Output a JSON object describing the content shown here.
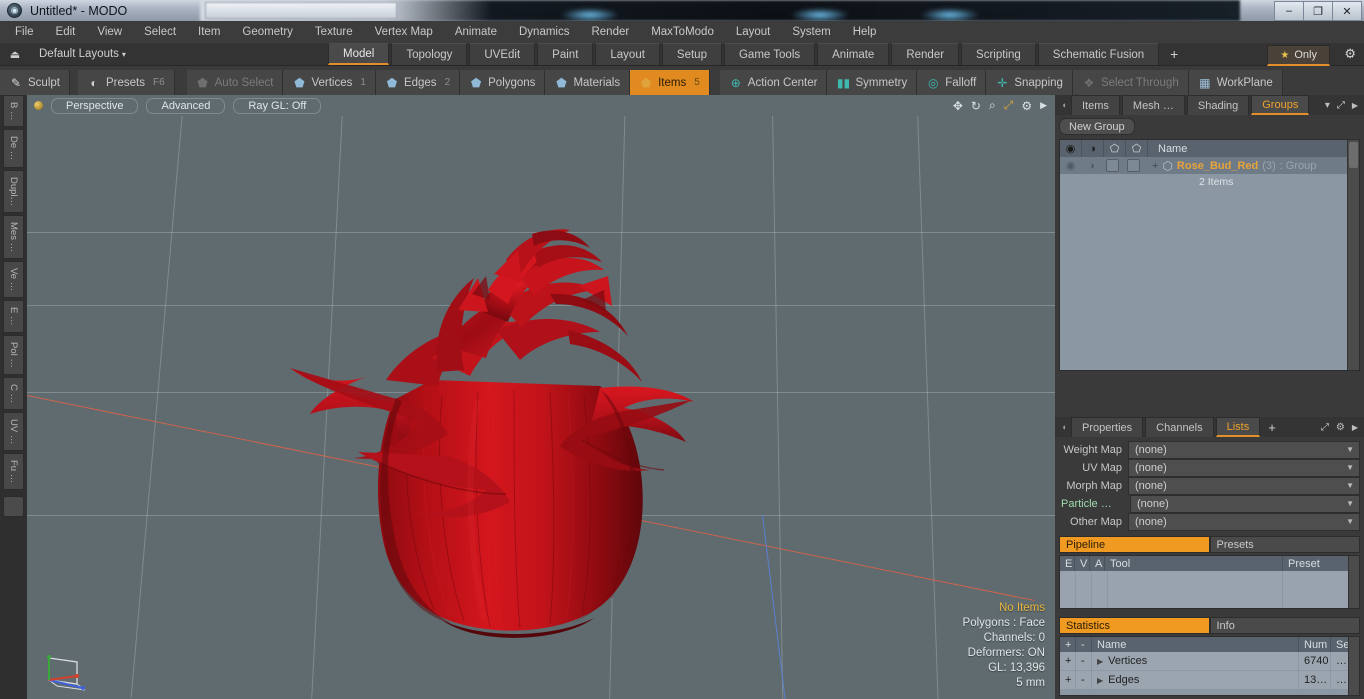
{
  "window": {
    "title": "Untitled* - MODO",
    "app_icon": "modo-logo-icon",
    "minimize": "–",
    "restore": "❐",
    "close": "✕"
  },
  "menubar": {
    "items": [
      "File",
      "Edit",
      "View",
      "Select",
      "Item",
      "Geometry",
      "Texture",
      "Vertex Map",
      "Animate",
      "Dynamics",
      "Render",
      "MaxToModo",
      "Layout",
      "System",
      "Help"
    ]
  },
  "layoutbar": {
    "home_icon": "home-icon",
    "layout_selector": "Default Layouts",
    "caret": "▾",
    "tabs": [
      {
        "label": "Model",
        "active": true
      },
      {
        "label": "Topology",
        "active": false
      },
      {
        "label": "UVEdit",
        "active": false
      },
      {
        "label": "Paint",
        "active": false
      },
      {
        "label": "Layout",
        "active": false
      },
      {
        "label": "Setup",
        "active": false
      },
      {
        "label": "Game Tools",
        "active": false
      },
      {
        "label": "Animate",
        "active": false
      },
      {
        "label": "Render",
        "active": false
      },
      {
        "label": "Scripting",
        "active": false
      },
      {
        "label": "Schematic Fusion",
        "active": false
      }
    ],
    "add_tab": "+",
    "only_label": "Only",
    "only_star": "★",
    "gear": "⚙"
  },
  "toolbar": {
    "items": [
      {
        "label": "Sculpt",
        "num": "",
        "icon": "pencil-icon",
        "state": "normal"
      },
      {
        "label": "Presets",
        "num": "F6",
        "icon": "sphere-icon",
        "state": "normal"
      },
      {
        "label": "Auto Select",
        "num": "",
        "icon": "cube-gray-icon",
        "state": "dim"
      },
      {
        "label": "Vertices",
        "num": "1",
        "icon": "cube-blue-icon",
        "state": "normal"
      },
      {
        "label": "Edges",
        "num": "2",
        "icon": "cube-blue-icon",
        "state": "normal"
      },
      {
        "label": "Polygons",
        "num": "",
        "icon": "cube-blue-icon",
        "state": "normal"
      },
      {
        "label": "Materials",
        "num": "",
        "icon": "cube-blue-icon",
        "state": "normal"
      },
      {
        "label": "Items",
        "num": "5",
        "icon": "cube-orange-icon",
        "state": "selected"
      },
      {
        "label": "Action Center",
        "num": "",
        "icon": "target-icon",
        "state": "normal"
      },
      {
        "label": "Symmetry",
        "num": "",
        "icon": "mirror-icon",
        "state": "normal"
      },
      {
        "label": "Falloff",
        "num": "",
        "icon": "circle-icon",
        "state": "normal"
      },
      {
        "label": "Snapping",
        "num": "",
        "icon": "snap-icon",
        "state": "normal"
      },
      {
        "label": "Select Through",
        "num": "",
        "icon": "select-through-icon",
        "state": "dim"
      },
      {
        "label": "WorkPlane",
        "num": "",
        "icon": "workplane-icon",
        "state": "normal"
      }
    ]
  },
  "left_strip": {
    "tabs": [
      "B …",
      "De …",
      "Dupl…",
      "Mes …",
      "Ve …",
      "E …",
      "Pol …",
      "C …",
      "UV …",
      "Fu …"
    ]
  },
  "viewport": {
    "dot": "viewport-menu-dot",
    "pills": [
      "Perspective",
      "Advanced",
      "Ray GL: Off"
    ],
    "nav_icons": [
      "move-icon",
      "rotate-icon",
      "zoom-icon",
      "maximize-icon",
      "gear-icon",
      "arrow-right-icon"
    ],
    "info": {
      "no_items": "No Items",
      "polygons": "Polygons : Face",
      "channels": "Channels: 0",
      "deformers": "Deformers: ON",
      "gl": "GL: 13,396",
      "scale": "5 mm"
    },
    "axis_gizmo": "axis-gizmo"
  },
  "right_panel": {
    "top_tabs": [
      {
        "label": "Items",
        "active": false
      },
      {
        "label": "Mesh …",
        "active": false
      },
      {
        "label": "Shading",
        "active": false
      },
      {
        "label": "Groups",
        "active": true
      }
    ],
    "top_tab_caret": "▾",
    "top_tab_icons": [
      "expand-icon",
      "arrow-right-icon"
    ],
    "new_group_button": "New Group",
    "group_list": {
      "columns": [
        "eye-icon",
        "render-icon",
        "shade-icon",
        "wire-icon"
      ],
      "name_header": "Name",
      "rows": [
        {
          "expand": "+",
          "icon": "group-shield-icon",
          "name": "Rose_Bud_Red",
          "count": "(3)",
          "type": ": Group",
          "sub": "2 Items"
        }
      ]
    },
    "bottom_tabs": [
      {
        "label": "Properties",
        "active": false
      },
      {
        "label": "Channels",
        "active": false
      },
      {
        "label": "Lists",
        "active": true
      }
    ],
    "bottom_tab_plus": "+",
    "bottom_tab_icons": [
      "expand-icon",
      "gear-icon",
      "arrow-right-icon"
    ],
    "lists": [
      {
        "label": "Weight Map",
        "value": "(none)"
      },
      {
        "label": "UV Map",
        "value": "(none)"
      },
      {
        "label": "Morph Map",
        "value": "(none)"
      },
      {
        "label": "Particle   …",
        "value": "(none)",
        "highlight": true
      },
      {
        "label": "Other Map",
        "value": "(none)"
      }
    ],
    "pipeline": {
      "tab_on": "Pipeline",
      "tab_off": "Presets",
      "columns": [
        "E",
        "V",
        "A",
        "Tool",
        "Preset"
      ],
      "rows": []
    },
    "statistics": {
      "tab_on": "Statistics",
      "tab_off": "Info",
      "columns": [
        "+",
        "-",
        "Name",
        "Num",
        "Sel"
      ],
      "rows": [
        {
          "plus": "+",
          "minus": "-",
          "tri": "▶",
          "name": "Vertices",
          "num": "6740",
          "sel": "…"
        },
        {
          "plus": "+",
          "minus": "-",
          "tri": "▶",
          "name": "Edges",
          "num": "13…",
          "sel": "…"
        }
      ]
    }
  },
  "colors": {
    "accent_orange": "#e08f2a",
    "viewport_bg": "#5f6b6f",
    "rose_red": "#c3141b",
    "panel_bg": "#3a3a3a",
    "list_bg": "#8b97a3"
  }
}
